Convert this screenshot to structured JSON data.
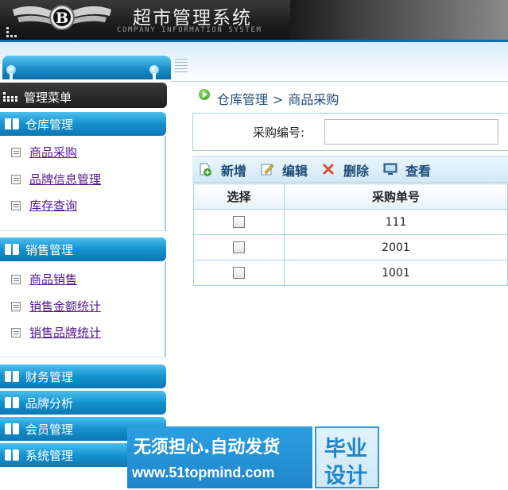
{
  "header": {
    "title": "超市管理系统",
    "subtitle": "COMPANY INFORMATION SYSTEM",
    "logo_letter": "B"
  },
  "sidebar": {
    "menu_title": "管理菜单",
    "groups": [
      {
        "label": "仓库管理",
        "items": [
          {
            "label": "商品采购"
          },
          {
            "label": "品牌信息管理"
          },
          {
            "label": "库存查询"
          }
        ]
      },
      {
        "label": "销售管理",
        "items": [
          {
            "label": "商品销售"
          },
          {
            "label": "销售金额统计"
          },
          {
            "label": "销售品牌统计"
          }
        ]
      },
      {
        "label": "财务管理",
        "items": []
      },
      {
        "label": "品牌分析",
        "items": []
      },
      {
        "label": "会员管理",
        "items": []
      },
      {
        "label": "系统管理",
        "items": []
      }
    ]
  },
  "breadcrumb": {
    "parent": "仓库管理",
    "separator": ">",
    "current": "商品采购"
  },
  "search": {
    "label": "采购编号:",
    "value": "",
    "placeholder": ""
  },
  "toolbar": {
    "add_label": "新增",
    "edit_label": "编辑",
    "delete_label": "删除",
    "view_label": "查看"
  },
  "table": {
    "headers": [
      "选择",
      "采购单号"
    ],
    "rows": [
      {
        "checked": false,
        "order_no": "111"
      },
      {
        "checked": false,
        "order_no": "2001"
      },
      {
        "checked": false,
        "order_no": "1001"
      }
    ]
  },
  "watermark": {
    "line1": "无须担心.自动发货",
    "line2": "www.51topmind.com",
    "badge_line1": "毕业",
    "badge_line2": "设计"
  },
  "colors": {
    "accent_blue": "#1592cf",
    "header_dark": "#1c1c1c",
    "link_visited": "#551a8b",
    "toolbar_text": "#1d4b78"
  }
}
